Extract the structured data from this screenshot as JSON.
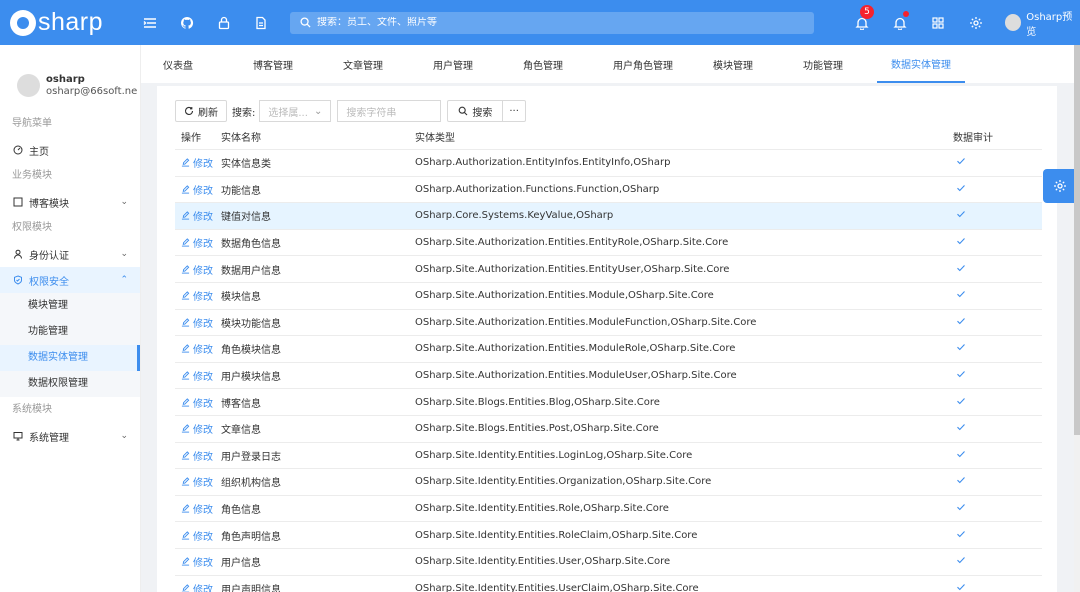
{
  "header": {
    "brand": "sharp",
    "search_placeholder": "搜索：员工、文件、照片等",
    "notification_count": "5",
    "user_name": "Osharp预览",
    "accent_color": "#3c8dee",
    "icons": [
      "menu-icon",
      "github-icon",
      "lock-icon",
      "document-icon",
      "bell-icon",
      "bell-plus-icon",
      "apps-grid-icon",
      "gear-icon"
    ]
  },
  "sidebar": {
    "profile": {
      "name": "osharp",
      "email": "osharp@66soft.ne"
    },
    "groups": {
      "nav_menu": "导航菜单",
      "business": "业务模块",
      "permission": "权限模块",
      "system": "系统模块"
    },
    "items": {
      "home": "主页",
      "blog": "博客模块",
      "identity": "身份认证",
      "security": "权限安全",
      "system_mgmt": "系统管理"
    },
    "security_sub": [
      "模块管理",
      "功能管理",
      "数据实体管理",
      "数据权限管理"
    ]
  },
  "tabs": [
    "仪表盘",
    "博客管理",
    "文章管理",
    "用户管理",
    "角色管理",
    "用户角色管理",
    "模块管理",
    "功能管理",
    "数据实体管理"
  ],
  "toolbar": {
    "refresh": "刷新",
    "search_label": "搜索:",
    "field_placeholder": "选择属...",
    "keyword_placeholder": "搜索字符串",
    "search_button": "搜索",
    "more": "···"
  },
  "table": {
    "headers": {
      "action": "操作",
      "name": "实体名称",
      "type": "实体类型",
      "audit": "数据审计"
    },
    "edit_label": "修改",
    "rows": [
      {
        "name": "实体信息类",
        "type": "OSharp.Authorization.EntityInfos.EntityInfo,OSharp"
      },
      {
        "name": "功能信息",
        "type": "OSharp.Authorization.Functions.Function,OSharp"
      },
      {
        "name": "键值对信息",
        "type": "OSharp.Core.Systems.KeyValue,OSharp"
      },
      {
        "name": "数据角色信息",
        "type": "OSharp.Site.Authorization.Entities.EntityRole,OSharp.Site.Core"
      },
      {
        "name": "数据用户信息",
        "type": "OSharp.Site.Authorization.Entities.EntityUser,OSharp.Site.Core"
      },
      {
        "name": "模块信息",
        "type": "OSharp.Site.Authorization.Entities.Module,OSharp.Site.Core"
      },
      {
        "name": "模块功能信息",
        "type": "OSharp.Site.Authorization.Entities.ModuleFunction,OSharp.Site.Core"
      },
      {
        "name": "角色模块信息",
        "type": "OSharp.Site.Authorization.Entities.ModuleRole,OSharp.Site.Core"
      },
      {
        "name": "用户模块信息",
        "type": "OSharp.Site.Authorization.Entities.ModuleUser,OSharp.Site.Core"
      },
      {
        "name": "博客信息",
        "type": "OSharp.Site.Blogs.Entities.Blog,OSharp.Site.Core"
      },
      {
        "name": "文章信息",
        "type": "OSharp.Site.Blogs.Entities.Post,OSharp.Site.Core"
      },
      {
        "name": "用户登录日志",
        "type": "OSharp.Site.Identity.Entities.LoginLog,OSharp.Site.Core"
      },
      {
        "name": "组织机构信息",
        "type": "OSharp.Site.Identity.Entities.Organization,OSharp.Site.Core"
      },
      {
        "name": "角色信息",
        "type": "OSharp.Site.Identity.Entities.Role,OSharp.Site.Core"
      },
      {
        "name": "角色声明信息",
        "type": "OSharp.Site.Identity.Entities.RoleClaim,OSharp.Site.Core"
      },
      {
        "name": "用户信息",
        "type": "OSharp.Site.Identity.Entities.User,OSharp.Site.Core"
      },
      {
        "name": "用户声明信息",
        "type": "OSharp.Site.Identity.Entities.UserClaim,OSharp.Site.Core"
      }
    ]
  }
}
